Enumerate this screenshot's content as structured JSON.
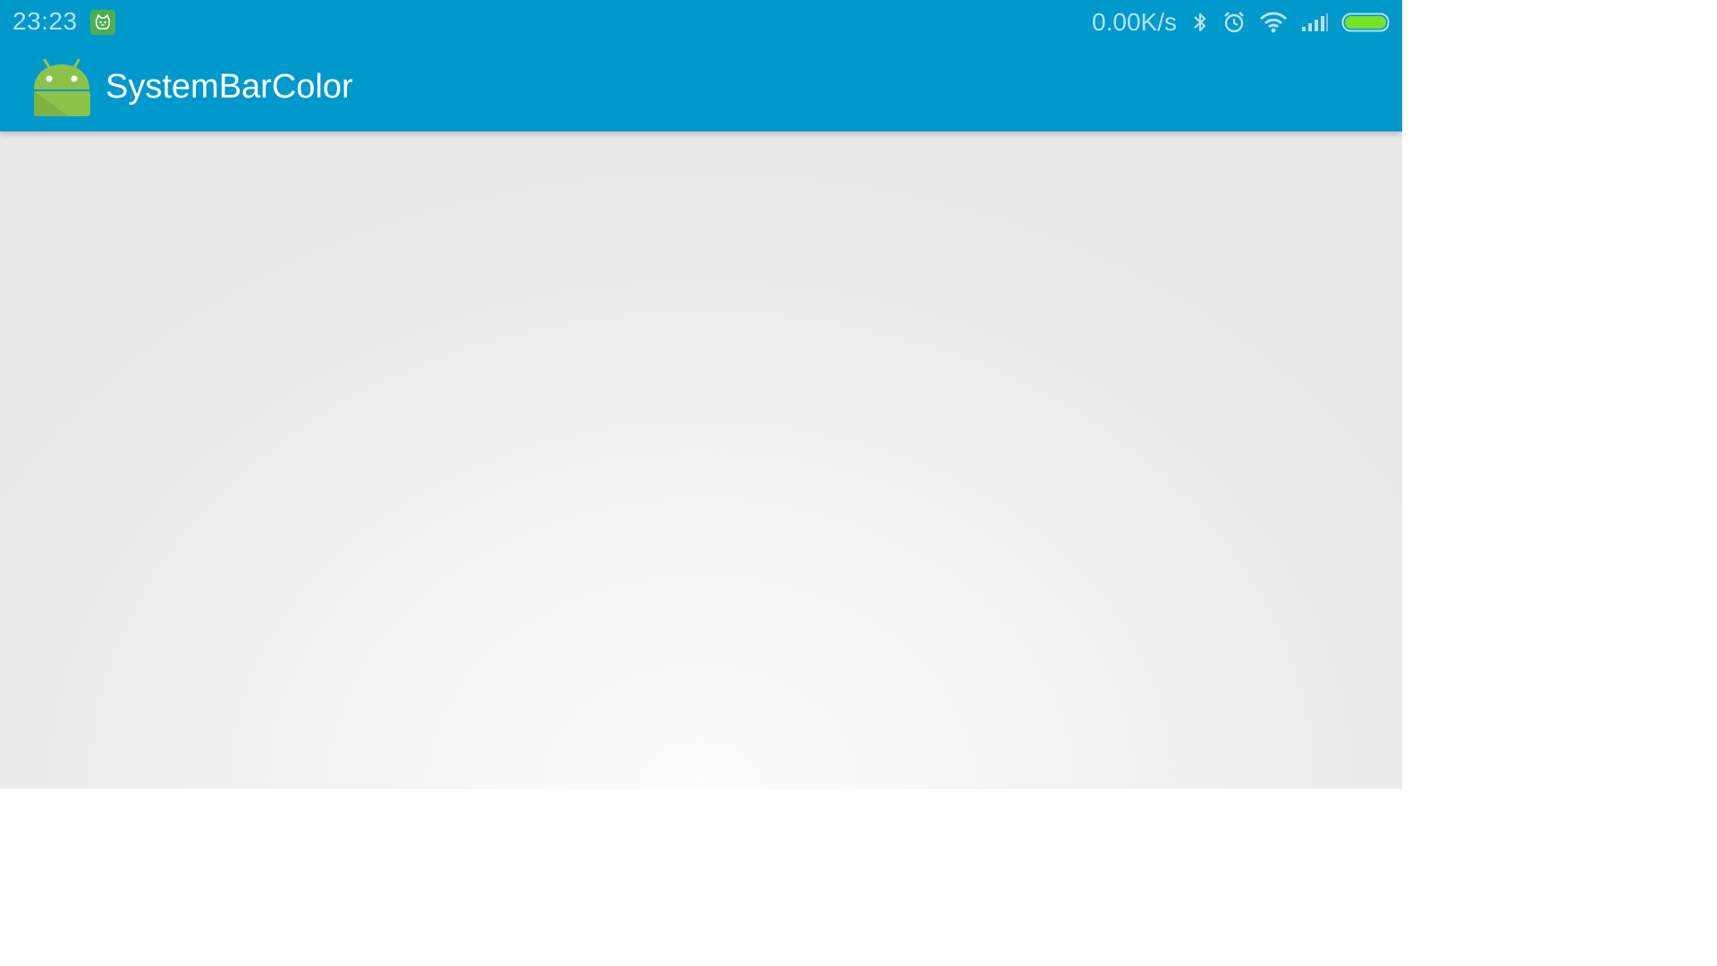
{
  "status_bar": {
    "time": "23:23",
    "network_speed": "0.00K/s",
    "notification_icon": "cat-notification-icon",
    "icons": [
      "bluetooth-icon",
      "alarm-icon",
      "wifi-icon",
      "signal-icon",
      "battery-icon"
    ],
    "battery_level": 1.0
  },
  "action_bar": {
    "app_icon": "android-icon",
    "title": "SystemBarColor"
  },
  "colors": {
    "accent": "#0099cc",
    "status_text": "#b9dff0",
    "battery": "#76e22a",
    "android_green": "#8bc34a"
  }
}
